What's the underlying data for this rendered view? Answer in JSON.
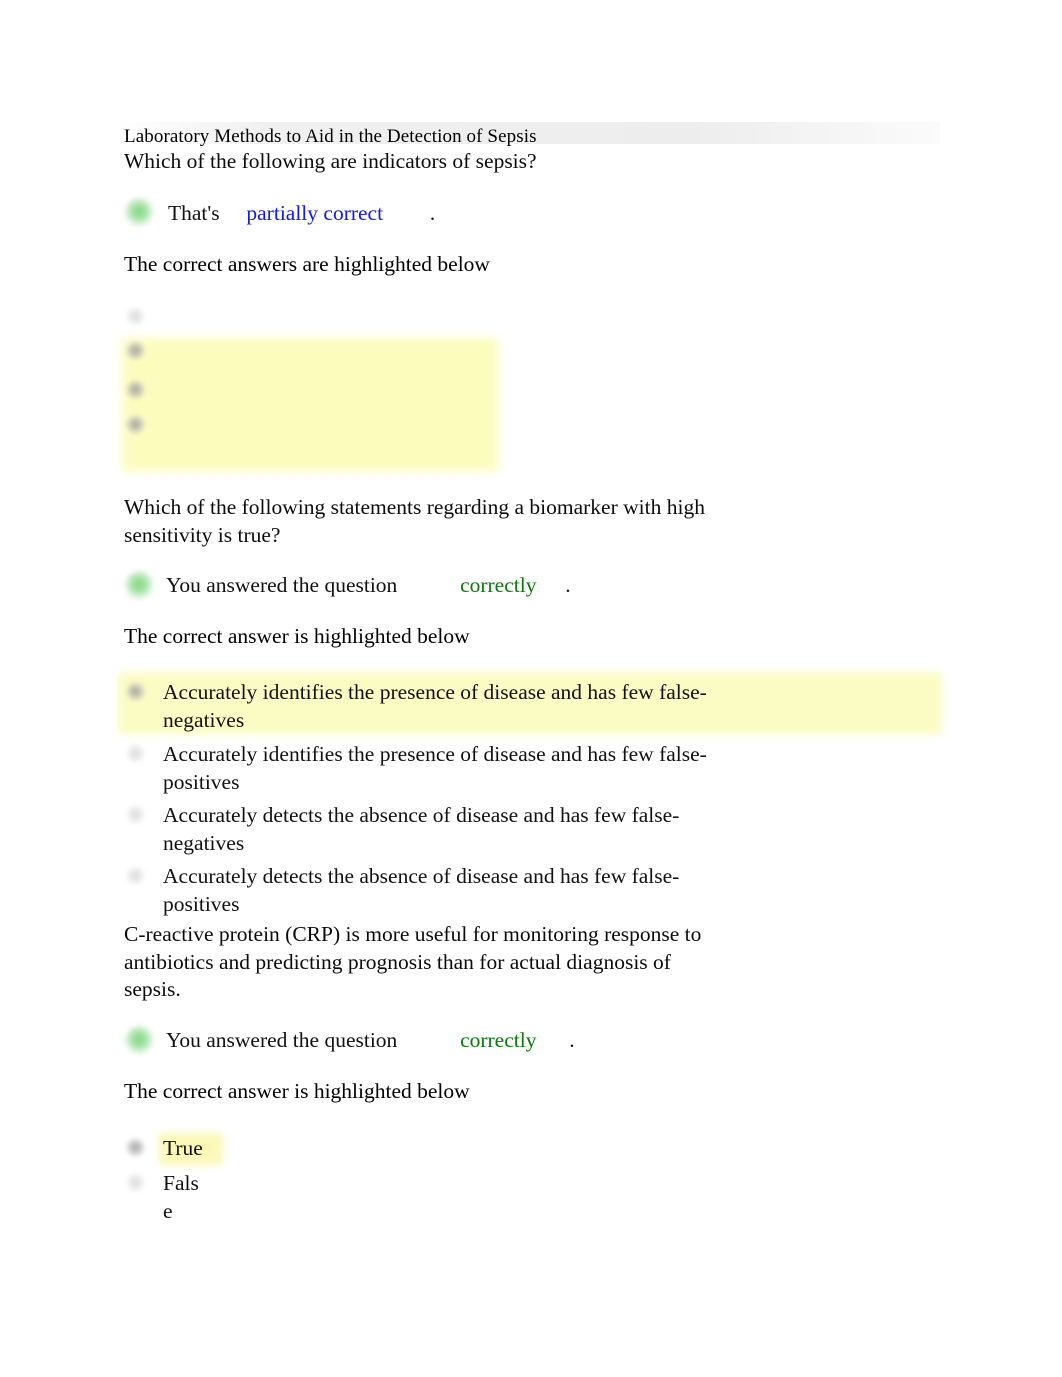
{
  "document": {
    "title": "Laboratory Methods to Aid in the Detection of Sepsis"
  },
  "questions": [
    {
      "id": "q1",
      "prompt": "Which of the following are indicators of sepsis?",
      "feedback": {
        "prefix": "That's",
        "verdict": "partially correct",
        "verdict_color": "#1018f0",
        "period": ".",
        "status_icon": "green-status-dot-icon"
      },
      "correct_answer_note": "The correct answers are highlighted below",
      "option_count": 4,
      "options": [
        {
          "label": "",
          "highlighted": false,
          "bullet": "checkbox-bullet-icon"
        },
        {
          "label": "",
          "highlighted": true,
          "bullet": "checkbox-bullet-icon"
        },
        {
          "label": "",
          "highlighted": true,
          "bullet": "checkbox-bullet-icon"
        },
        {
          "label": "",
          "highlighted": true,
          "bullet": "checkbox-bullet-icon"
        }
      ]
    },
    {
      "id": "q2",
      "prompt_line1": "Which of the following statements regarding a biomarker with high",
      "prompt_line2": "sensitivity is true?",
      "feedback": {
        "prefix": "You answered the question",
        "verdict": "correctly",
        "verdict_color": "#0a7a0a",
        "period": ".",
        "status_icon": "green-status-dot-icon"
      },
      "correct_answer_note": "The correct answer is highlighted below",
      "options": [
        {
          "line1": "Accurately identifies the presence of disease and has few false-",
          "line2": "negatives",
          "highlighted": true,
          "bullet": "radio-bullet-icon"
        },
        {
          "line1": "Accurately identifies the presence of disease and has few false-",
          "line2": "positives",
          "highlighted": false,
          "bullet": "radio-bullet-icon"
        },
        {
          "line1": "Accurately detects the absence of disease and has few false-",
          "line2": "negatives",
          "highlighted": false,
          "bullet": "radio-bullet-icon"
        },
        {
          "line1": "Accurately detects the absence of disease and has few false-",
          "line2": "positives",
          "highlighted": false,
          "bullet": "radio-bullet-icon"
        }
      ]
    },
    {
      "id": "q3",
      "prompt_line1": "C-reactive protein (CRP) is more useful for monitoring response to",
      "prompt_line2": "antibiotics and predicting prognosis than for actual diagnosis of",
      "prompt_line3": "sepsis.",
      "feedback": {
        "prefix": "You answered the question",
        "verdict": "correctly",
        "verdict_color": "#0a7a0a",
        "period": ".",
        "status_icon": "green-status-dot-icon"
      },
      "correct_answer_note": "The correct answer is highlighted below",
      "options": [
        {
          "line1": "True",
          "line2": "",
          "highlighted": true,
          "bullet": "radio-bullet-icon"
        },
        {
          "line1": "Fals",
          "line2": "e",
          "highlighted": false,
          "bullet": "radio-bullet-icon"
        }
      ]
    }
  ],
  "colors": {
    "highlight_yellow": "#fcfcb8",
    "link_blue": "#1018f0",
    "correct_green": "#0a7a0a",
    "title_band_gray": "#ededed"
  }
}
